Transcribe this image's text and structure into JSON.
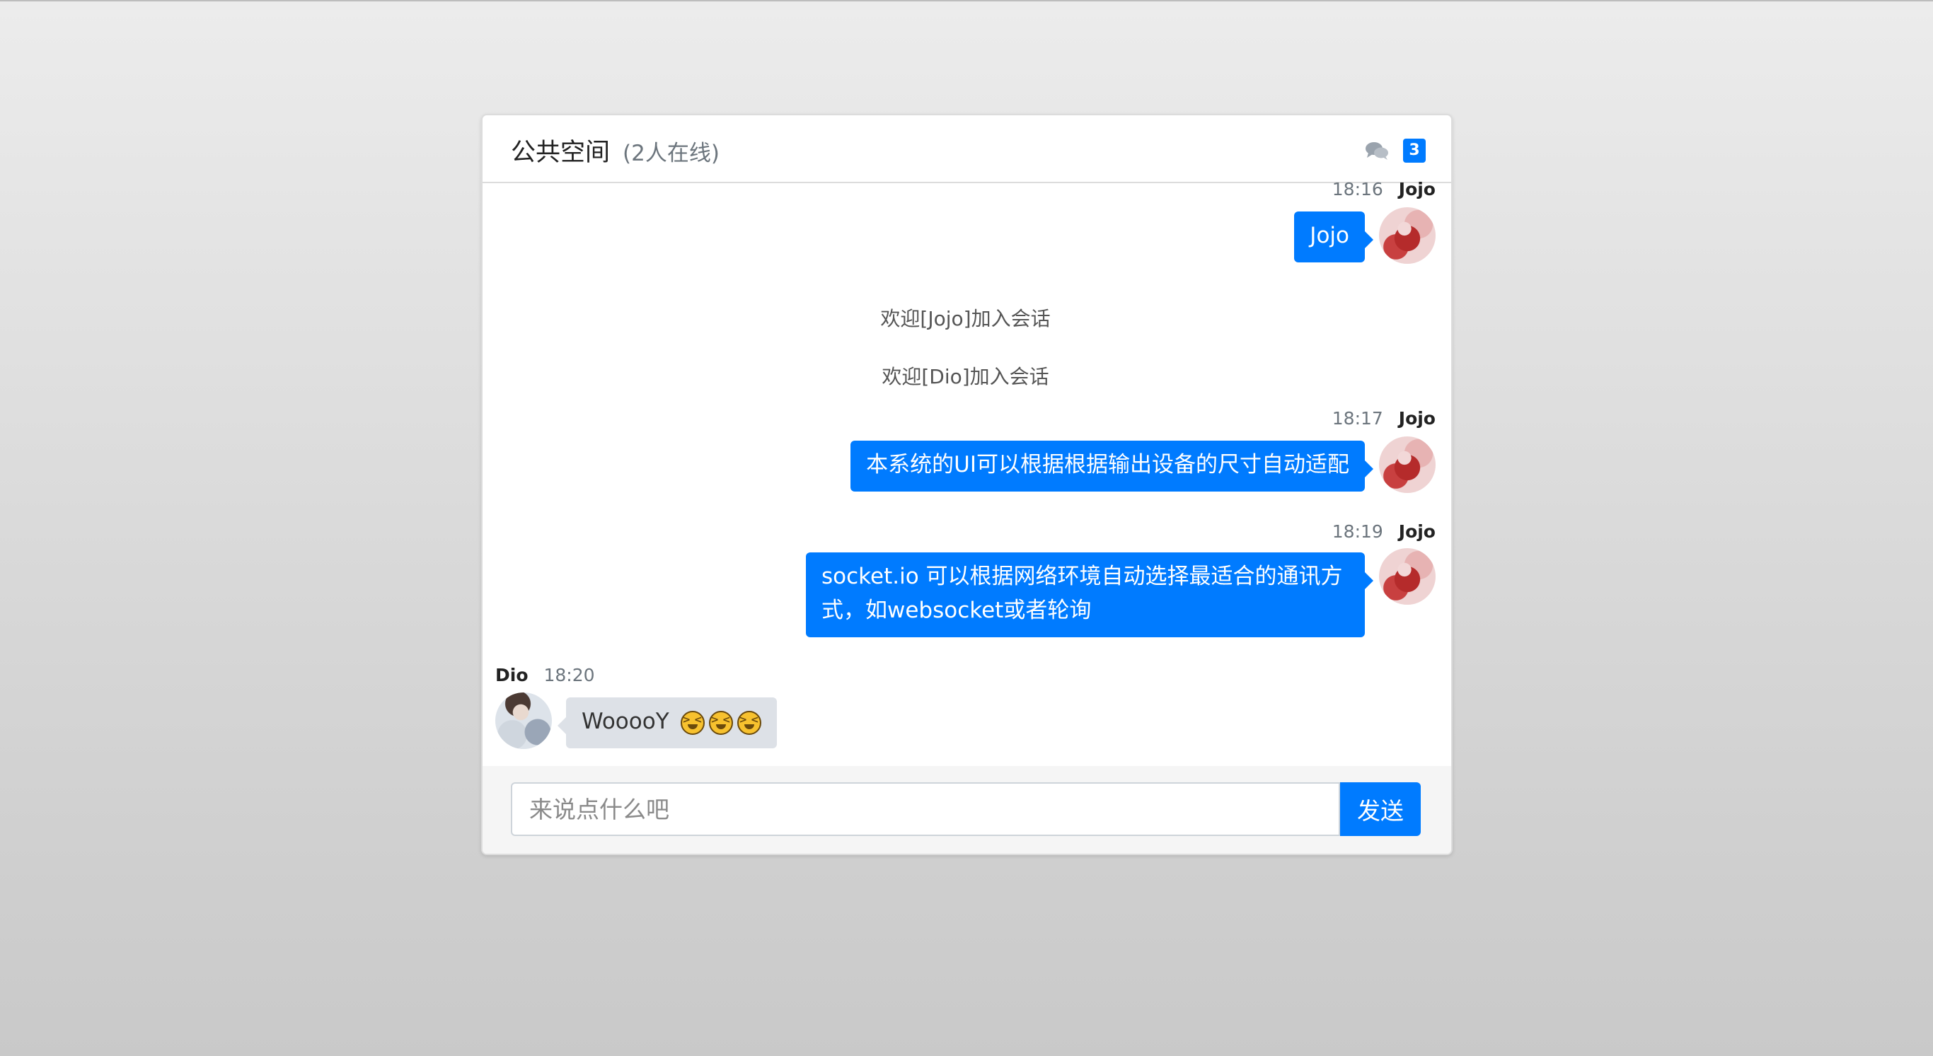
{
  "header": {
    "room_title": "公共空间",
    "online_count": "(2人在线)",
    "badge_count": "3"
  },
  "messages": [
    {
      "type": "mine",
      "time": "18:16",
      "name": "Jojo",
      "text": "Jojo"
    },
    {
      "type": "system",
      "text": "欢迎[Jojo]加入会话"
    },
    {
      "type": "system",
      "text": "欢迎[Dio]加入会话"
    },
    {
      "type": "mine",
      "time": "18:17",
      "name": "Jojo",
      "text": "本系统的UI可以根据根据输出设备的尺寸自动适配"
    },
    {
      "type": "mine",
      "time": "18:19",
      "name": "Jojo",
      "text": "socket.io 可以根据网络环境自动选择最适合的通讯方式，如websocket或者轮询"
    },
    {
      "type": "theirs",
      "time": "18:20",
      "name": "Dio",
      "text": "WooooY",
      "emoji_count": 3,
      "emoji": "laughing-face-icon"
    }
  ],
  "composer": {
    "placeholder": "来说点什么吧",
    "send_label": "发送"
  },
  "colors": {
    "accent": "#007bff",
    "their_bubble": "#dde1e7"
  }
}
